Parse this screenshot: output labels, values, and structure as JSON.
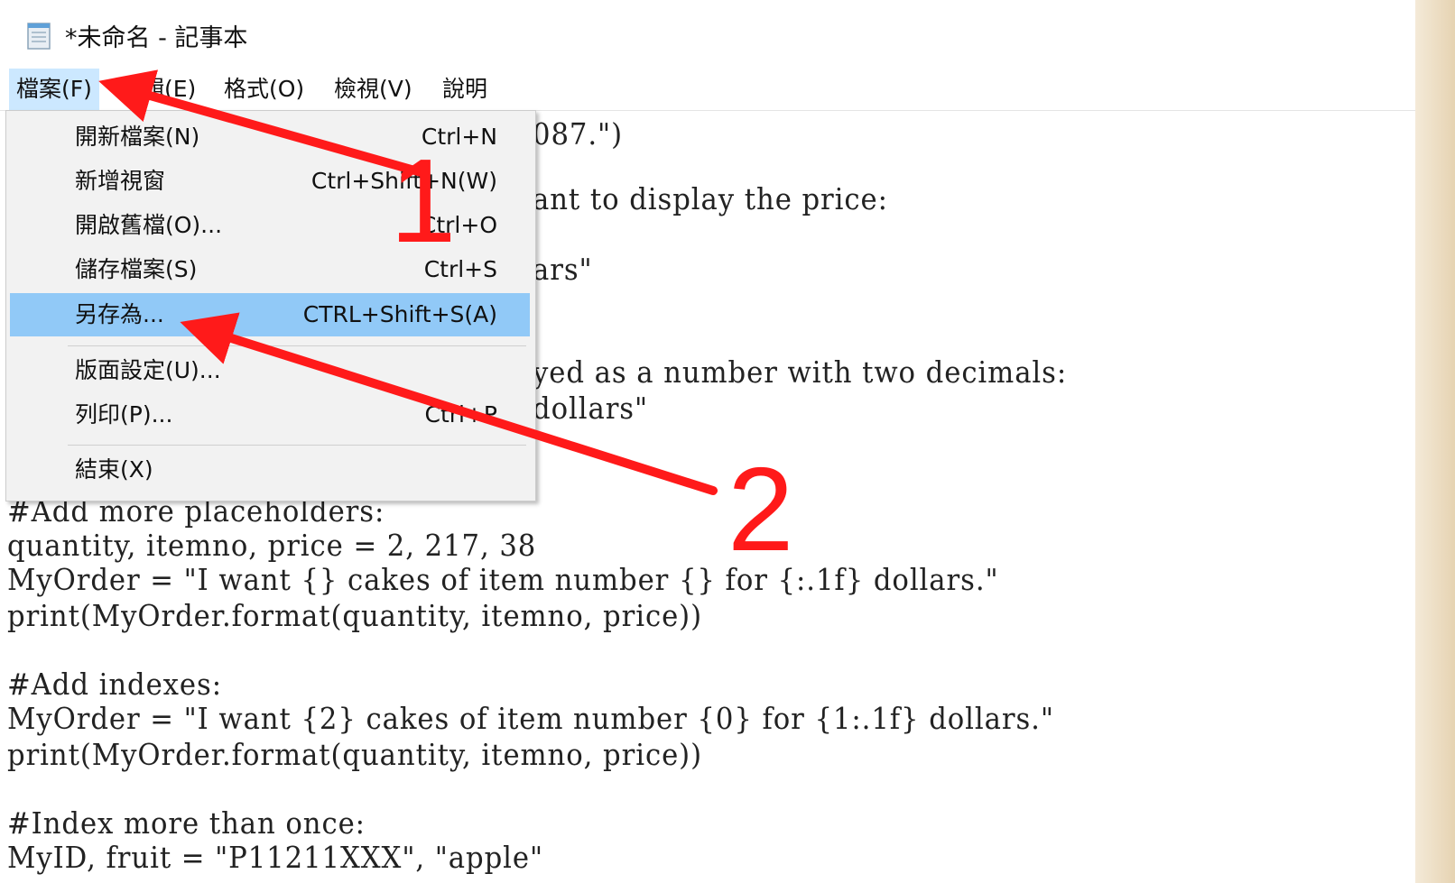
{
  "window": {
    "title": "*未命名 - 記事本",
    "icon": "notepad-icon"
  },
  "menubar": {
    "items": [
      {
        "label": "檔案(F)"
      },
      {
        "label": "編輯(E)"
      },
      {
        "label": "格式(O)"
      },
      {
        "label": "檢視(V)"
      },
      {
        "label": "說明"
      }
    ]
  },
  "file_menu": {
    "items": [
      {
        "label": "開新檔案(N)",
        "shortcut": "Ctrl+N"
      },
      {
        "label": "新增視窗",
        "shortcut": "Ctrl+Shift+N(W)"
      },
      {
        "label": "開啟舊檔(O)...",
        "shortcut": "Ctrl+O"
      },
      {
        "label": "儲存檔案(S)",
        "shortcut": "Ctrl+S"
      },
      {
        "label": "另存為...",
        "shortcut": "CTRL+Shift+S(A)"
      },
      {
        "label": "版面設定(U)...",
        "shortcut": ""
      },
      {
        "label": "列印(P)...",
        "shortcut": "Ctrl+P"
      },
      {
        "label": "結束(X)",
        "shortcut": ""
      }
    ],
    "highlighted_item": "另存為..."
  },
  "editor": {
    "visible_fragments": [
      "087.\")",
      "ant to display the price:",
      "ars\"",
      "yed as a number with two decimals:",
      "dollars\""
    ],
    "lines": [
      "#Add more placeholders:",
      "quantity, itemno, price = 2, 217, 38",
      "MyOrder = \"I want {} cakes of item number {} for {:.1f} dollars.\"",
      "print(MyOrder.format(quantity, itemno, price))",
      "",
      "#Add indexes:",
      "MyOrder = \"I want {2} cakes of item number {0} for {1:.1f} dollars.\"",
      "print(MyOrder.format(quantity, itemno, price))",
      "",
      "#Index more than once:",
      "MyID, fruit = \"P11211XXX\", \"apple\""
    ]
  },
  "annotations": {
    "step1_label": "1",
    "step2_label": "2",
    "color": "#ff1a1a"
  }
}
